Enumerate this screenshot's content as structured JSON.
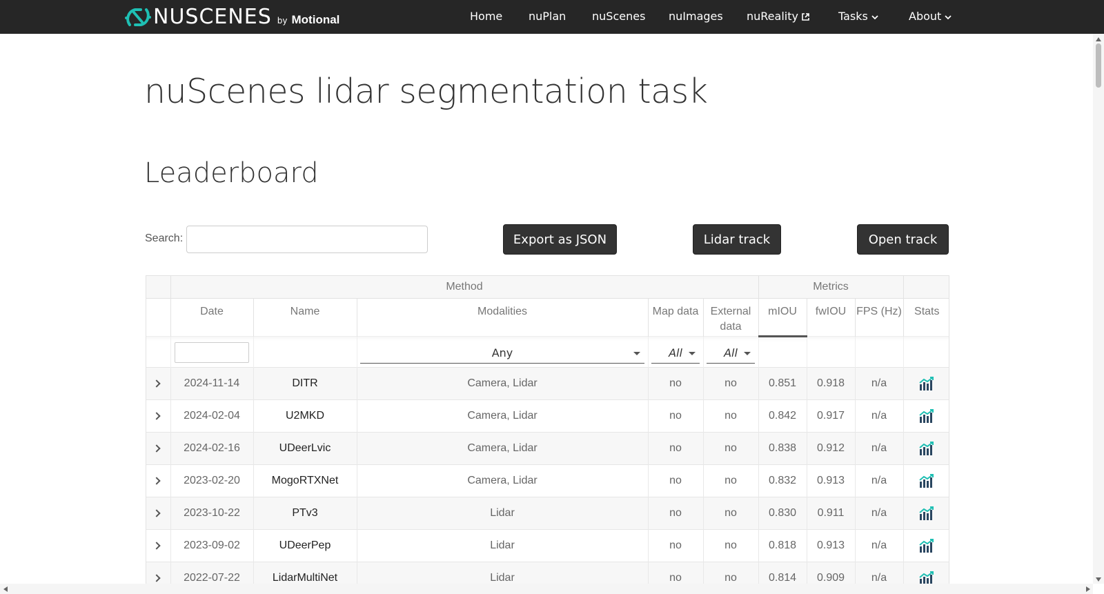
{
  "brand": {
    "wordmark": "NUSCENES",
    "by": "by",
    "company": "Motional",
    "accent": "#1ebfb3"
  },
  "nav": {
    "items": [
      {
        "label": "Home",
        "icon": ""
      },
      {
        "label": "nuPlan",
        "icon": ""
      },
      {
        "label": "nuScenes",
        "icon": ""
      },
      {
        "label": "nuImages",
        "icon": ""
      },
      {
        "label": "nuReality",
        "icon": "external-link-icon"
      },
      {
        "label": "Tasks",
        "icon": "chevron-down-icon"
      },
      {
        "label": "About",
        "icon": "chevron-down-icon"
      }
    ]
  },
  "page": {
    "title": "nuScenes lidar segmentation task",
    "section": "Leaderboard"
  },
  "controls": {
    "search_label": "Search:",
    "search_value": "",
    "export_label": "Export as JSON",
    "lidar_track_label": "Lidar track",
    "open_track_label": "Open track"
  },
  "table": {
    "groups": {
      "method": "Method",
      "metrics": "Metrics"
    },
    "columns": {
      "date": "Date",
      "name": "Name",
      "modalities": "Modalities",
      "map_data": "Map data",
      "external_data": "External data",
      "miou": "mIOU",
      "fwiou": "fwIOU",
      "fps": "FPS (Hz)",
      "stats": "Stats"
    },
    "filters": {
      "modalities": "Any",
      "map_data": "All",
      "external_data": "All"
    },
    "rows": [
      {
        "date": "2024-11-14",
        "name": "DITR",
        "modalities": "Camera, Lidar",
        "map_data": "no",
        "external_data": "no",
        "miou": "0.851",
        "fwiou": "0.918",
        "fps": "n/a"
      },
      {
        "date": "2024-02-04",
        "name": "U2MKD",
        "modalities": "Camera, Lidar",
        "map_data": "no",
        "external_data": "no",
        "miou": "0.842",
        "fwiou": "0.917",
        "fps": "n/a"
      },
      {
        "date": "2024-02-16",
        "name": "UDeerLvic",
        "modalities": "Camera, Lidar",
        "map_data": "no",
        "external_data": "no",
        "miou": "0.838",
        "fwiou": "0.912",
        "fps": "n/a"
      },
      {
        "date": "2023-02-20",
        "name": "MogoRTXNet",
        "modalities": "Camera, Lidar",
        "map_data": "no",
        "external_data": "no",
        "miou": "0.832",
        "fwiou": "0.913",
        "fps": "n/a"
      },
      {
        "date": "2023-10-22",
        "name": "PTv3",
        "modalities": "Lidar",
        "map_data": "no",
        "external_data": "no",
        "miou": "0.830",
        "fwiou": "0.911",
        "fps": "n/a"
      },
      {
        "date": "2023-09-02",
        "name": "UDeerPep",
        "modalities": "Lidar",
        "map_data": "no",
        "external_data": "no",
        "miou": "0.818",
        "fwiou": "0.913",
        "fps": "n/a"
      },
      {
        "date": "2022-07-22",
        "name": "LidarMultiNet",
        "modalities": "Lidar",
        "map_data": "no",
        "external_data": "no",
        "miou": "0.814",
        "fwiou": "0.909",
        "fps": "n/a"
      }
    ]
  }
}
